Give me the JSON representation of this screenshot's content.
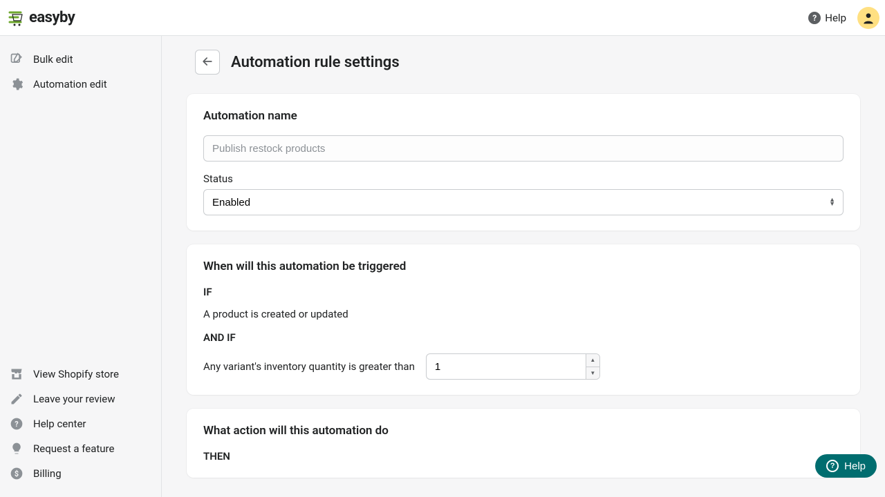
{
  "brand": {
    "name": "easyby"
  },
  "topbar": {
    "help_label": "Help"
  },
  "sidebar": {
    "top": [
      {
        "label": "Bulk edit",
        "icon": "edit-square-icon"
      },
      {
        "label": "Automation edit",
        "icon": "gear-icon"
      }
    ],
    "bottom": [
      {
        "label": "View Shopify store",
        "icon": "store-icon"
      },
      {
        "label": "Leave your review",
        "icon": "pencil-icon"
      },
      {
        "label": "Help center",
        "icon": "question-circle-icon"
      },
      {
        "label": "Request a feature",
        "icon": "lightbulb-icon"
      },
      {
        "label": "Billing",
        "icon": "dollar-circle-icon"
      }
    ]
  },
  "page": {
    "title": "Automation rule settings"
  },
  "card_name": {
    "title": "Automation name",
    "name_placeholder": "Publish restock products",
    "name_value": "",
    "status_label": "Status",
    "status_value": "Enabled"
  },
  "card_trigger": {
    "title": "When will this automation be triggered",
    "if_label": "IF",
    "if_text": "A product is created or updated",
    "andif_label": "AND IF",
    "andif_text": "Any variant's inventory quantity is greater than",
    "qty_value": "1"
  },
  "card_action": {
    "title": "What action will this automation do",
    "then_label": "THEN"
  },
  "fab": {
    "label": "Help"
  }
}
